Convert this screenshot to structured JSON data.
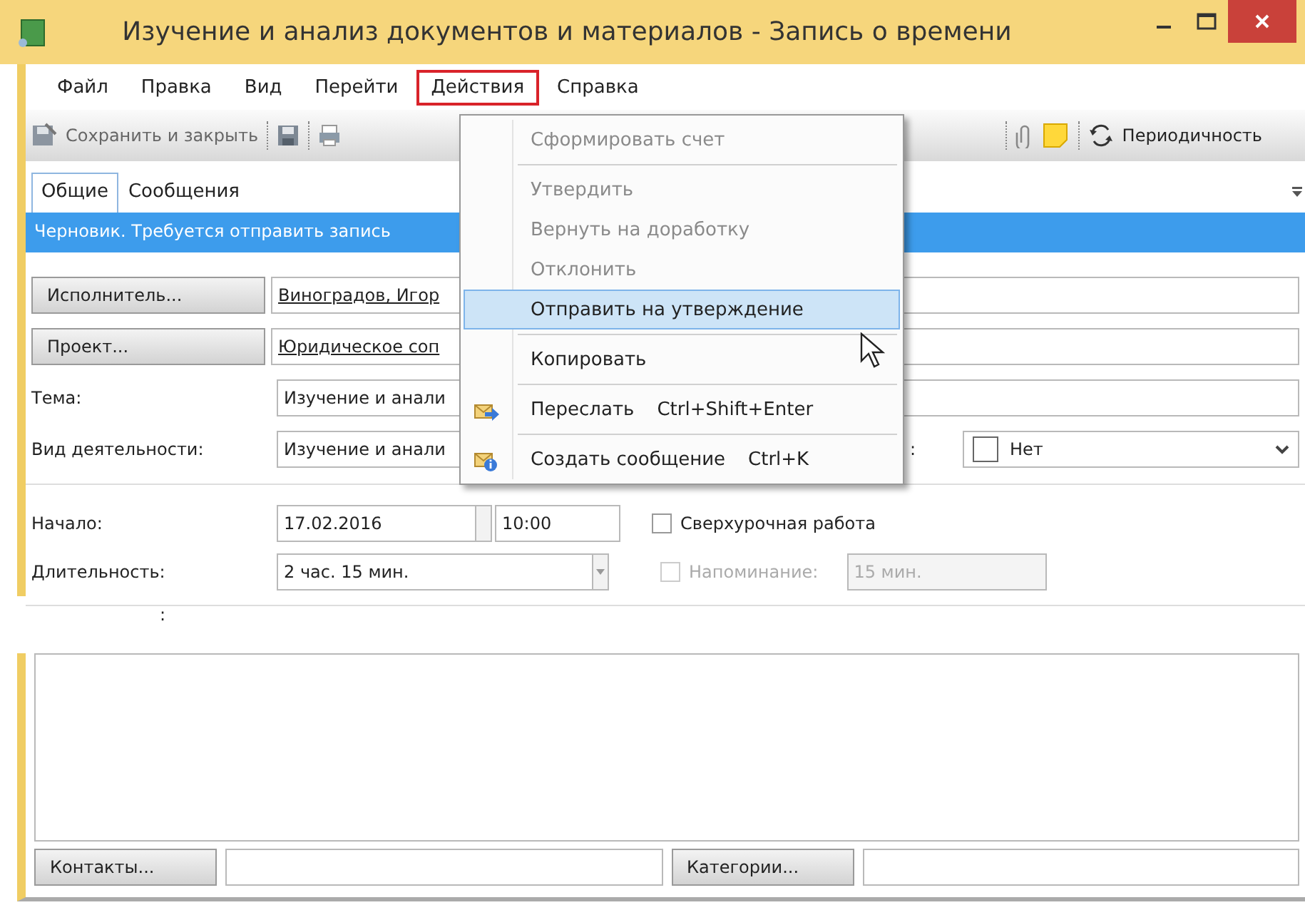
{
  "window": {
    "title": "Изучение и анализ документов и материалов - Запись о времени"
  },
  "menubar": [
    {
      "label": "Файл",
      "selected": false
    },
    {
      "label": "Правка",
      "selected": false
    },
    {
      "label": "Вид",
      "selected": false
    },
    {
      "label": "Перейти",
      "selected": false
    },
    {
      "label": "Действия",
      "selected": true
    },
    {
      "label": "Справка",
      "selected": false
    }
  ],
  "toolbar": {
    "save_close": "Сохранить и закрыть",
    "recurrence": "Периодичность"
  },
  "tabs": [
    {
      "label": "Общие",
      "selected": true
    },
    {
      "label": "Сообщения",
      "selected": false
    }
  ],
  "info_bar": {
    "text": "Черновик. Требуется отправить запись"
  },
  "form": {
    "executor": {
      "button": "Исполнитель...",
      "value": "Виноградов, Игор"
    },
    "project": {
      "button": "Проект...",
      "value": "Юридическое соп"
    },
    "subject": {
      "label": "Тема:",
      "value": "Изучение и анали"
    },
    "activity": {
      "label": "Вид деятельности:",
      "value": "Изучение и анали"
    },
    "billing": {
      "label": ":",
      "checked": false,
      "value": "Нет"
    },
    "start": {
      "label": "Начало:",
      "date": "17.02.2016",
      "time": "10:00"
    },
    "overtime": {
      "label": "Сверхурочная работа",
      "checked": false,
      "disabled": false
    },
    "duration": {
      "label": "Длительность:",
      "value": "2 час. 15 мин."
    },
    "reminder": {
      "label": "Напоминание:",
      "checked": false,
      "disabled": true,
      "value": "15 мин."
    }
  },
  "notes": {
    "label": ":"
  },
  "footer": {
    "contacts": "Контакты...",
    "categories": "Категории..."
  },
  "menu": {
    "items": [
      {
        "kind": "item",
        "label": "Сформировать счет",
        "disabled": true,
        "selected": false
      },
      {
        "kind": "separator"
      },
      {
        "kind": "item",
        "label": "Утвердить",
        "disabled": true,
        "selected": false
      },
      {
        "kind": "item",
        "label": "Вернуть на доработку",
        "disabled": true,
        "selected": false
      },
      {
        "kind": "item",
        "label": "Отклонить",
        "disabled": true,
        "selected": false
      },
      {
        "kind": "item",
        "label": "Отправить на утверждение",
        "disabled": false,
        "selected": true
      },
      {
        "kind": "separator"
      },
      {
        "kind": "item",
        "label": "Копировать",
        "disabled": false,
        "selected": false
      },
      {
        "kind": "separator"
      },
      {
        "kind": "item",
        "label": "Переслать",
        "shortcut": "Ctrl+Shift+Enter",
        "disabled": false,
        "selected": false
      },
      {
        "kind": "separator"
      },
      {
        "kind": "item",
        "label": "Создать сообщение",
        "shortcut": "Ctrl+K",
        "disabled": false,
        "selected": false
      }
    ]
  }
}
